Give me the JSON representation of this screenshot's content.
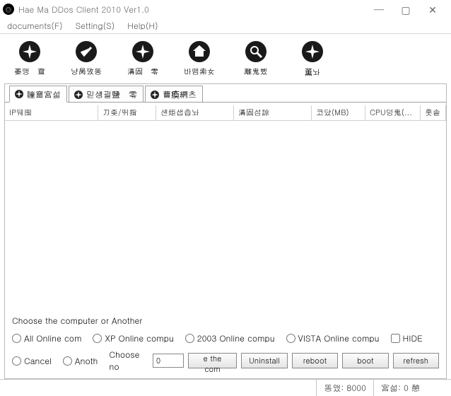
{
  "window": {
    "title": "Hae Ma DDos Client 2010 Ver1.0"
  },
  "menu": {
    "documents": "documents(F)",
    "setting": "Setting(S)",
    "help": "Help(H)"
  },
  "toolbar": [
    {
      "label": "萎맹　窟"
    },
    {
      "label": "냥昺攷똥"
    },
    {
      "label": "溝固　零"
    },
    {
      "label": "바뗌索女"
    },
    {
      "label": "離鬼뼸"
    },
    {
      "label": "薫놔"
    }
  ],
  "tabs": {
    "t1": "瞳窟宮섧",
    "t2": "믿섕괼鹽　零",
    "t3": "曹瘓網츠"
  },
  "columns": {
    "c1": "IP뒈囹",
    "c2": "刀좆/뛰指",
    "c3": "섄炬샙츱놔",
    "c4": "溝固섬諒",
    "c5": "코닸(MB)",
    "c6": "CPU덩鬼(...",
    "c7": "홋솥"
  },
  "chooser": {
    "title": "Choose the computer or Another",
    "r1": "All Online com",
    "r2": "XP Online compu",
    "r3": "2003 Online compu",
    "r4": "VISTA Online compu",
    "hide": "HIDE",
    "r5": "Cancel",
    "r6": "Anoth",
    "choose_no": "Choose no",
    "numval": "0",
    "b1": "e the com",
    "b2": "Uninstall",
    "b3": "reboot",
    "b4": "boot",
    "b5": "refresh"
  },
  "status": {
    "s1": "똥앴: 8000",
    "s2": "宮섧: 0 憩"
  }
}
